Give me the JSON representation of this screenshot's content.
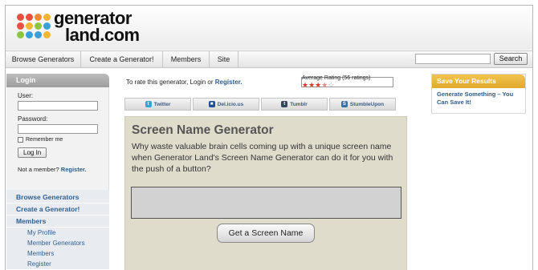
{
  "logo": {
    "line1": "generator",
    "line2": "land.com",
    "dot_colors": [
      "#e9503f",
      "#e9503f",
      "#f08b33",
      "#f2b632",
      "#e9503f",
      "#f2b632",
      "#8cc63e",
      "#3aa1d8",
      "#8cc63e",
      "#3aa1d8",
      "#3aa1d8",
      "#f2b632"
    ]
  },
  "nav": {
    "items": [
      "Browse Generators",
      "Create a Generator!",
      "Members",
      "Site"
    ],
    "search_label": "Search",
    "search_value": ""
  },
  "login": {
    "heading": "Login",
    "user_label": "User:",
    "password_label": "Password:",
    "remember_label": "Remember me",
    "button_label": "Log In",
    "not_member_text": "Not a member?",
    "register_link": "Register."
  },
  "sidebar": {
    "links": [
      "Browse Generators",
      "Create a Generator!",
      "Members"
    ],
    "sub_links": [
      "My Profile",
      "Member Generators",
      "Members",
      "Register"
    ]
  },
  "rating": {
    "prompt": "To rate this generator, Login or",
    "register_link": "Register.",
    "label": "Average Rating (56 ratings)",
    "stars_value": 3.5,
    "stars_max": 5
  },
  "share": {
    "items": [
      {
        "label": "Twitter",
        "icon": "twitter-icon",
        "color": "#3aa1d8",
        "glyph": "t"
      },
      {
        "label": "Del.icio.us",
        "icon": "delicious-icon",
        "color": "#1f4e9a",
        "glyph": "■"
      },
      {
        "label": "Tumblr",
        "icon": "tumblr-icon",
        "color": "#35465c",
        "glyph": "t"
      },
      {
        "label": "StumbleUpon",
        "icon": "stumbleupon-icon",
        "color": "#3a6ea5",
        "glyph": "S"
      }
    ]
  },
  "generator": {
    "title": "Screen Name Generator",
    "description": "Why waste valuable brain cells coming up with a unique screen name when Generator Land's Screen Name Generator can do it for you with the push of a button?",
    "output": "",
    "button_label": "Get a Screen Name"
  },
  "save": {
    "heading": "Save Your Results",
    "text": "Generate Something – You Can Save It!"
  }
}
